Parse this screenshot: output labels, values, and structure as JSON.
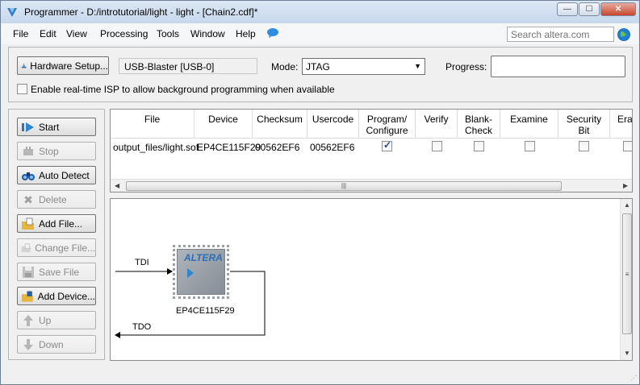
{
  "window": {
    "title": "Programmer - D:/introtutorial/light - light - [Chain2.cdf]*",
    "controls": {
      "minimize": "—",
      "maximize": "☐",
      "close": "✕"
    }
  },
  "menu": {
    "items": [
      "File",
      "Edit",
      "View",
      "Processing",
      "Tools",
      "Window",
      "Help"
    ],
    "search_placeholder": "Search altera.com"
  },
  "hardware": {
    "setup_label": "Hardware Setup...",
    "device": "USB-Blaster [USB-0]",
    "mode_label": "Mode:",
    "mode_value": "JTAG",
    "progress_label": "Progress:",
    "isp_label": "Enable real-time ISP to allow background programming when available",
    "isp_checked": false
  },
  "buttons": [
    {
      "id": "start",
      "label": "Start",
      "enabled": true
    },
    {
      "id": "stop",
      "label": "Stop",
      "enabled": false
    },
    {
      "id": "auto-detect",
      "label": "Auto Detect",
      "enabled": true
    },
    {
      "id": "delete",
      "label": "Delete",
      "enabled": false
    },
    {
      "id": "add-file",
      "label": "Add File...",
      "enabled": true
    },
    {
      "id": "change-file",
      "label": "Change File...",
      "enabled": false
    },
    {
      "id": "save-file",
      "label": "Save File",
      "enabled": false
    },
    {
      "id": "add-device",
      "label": "Add Device...",
      "enabled": true
    },
    {
      "id": "up",
      "label": "Up",
      "enabled": false
    },
    {
      "id": "down",
      "label": "Down",
      "enabled": false
    }
  ],
  "table": {
    "columns": [
      "File",
      "Device",
      "Checksum",
      "Usercode",
      "Program/\nConfigure",
      "Verify",
      "Blank-\nCheck",
      "Examine",
      "Security\nBit",
      "Erase"
    ],
    "rows": [
      {
        "file": "output_files/light.sof",
        "device": "EP4CE115F29",
        "checksum": "00562EF6",
        "usercode": "00562EF6",
        "program": true,
        "verify": false,
        "blank_check": false,
        "examine": false,
        "security_bit": false,
        "erase": false
      }
    ]
  },
  "chain": {
    "tdi": "TDI",
    "tdo": "TDO",
    "chip_logo": "ALTERA",
    "chip_name": "EP4CE115F29"
  }
}
